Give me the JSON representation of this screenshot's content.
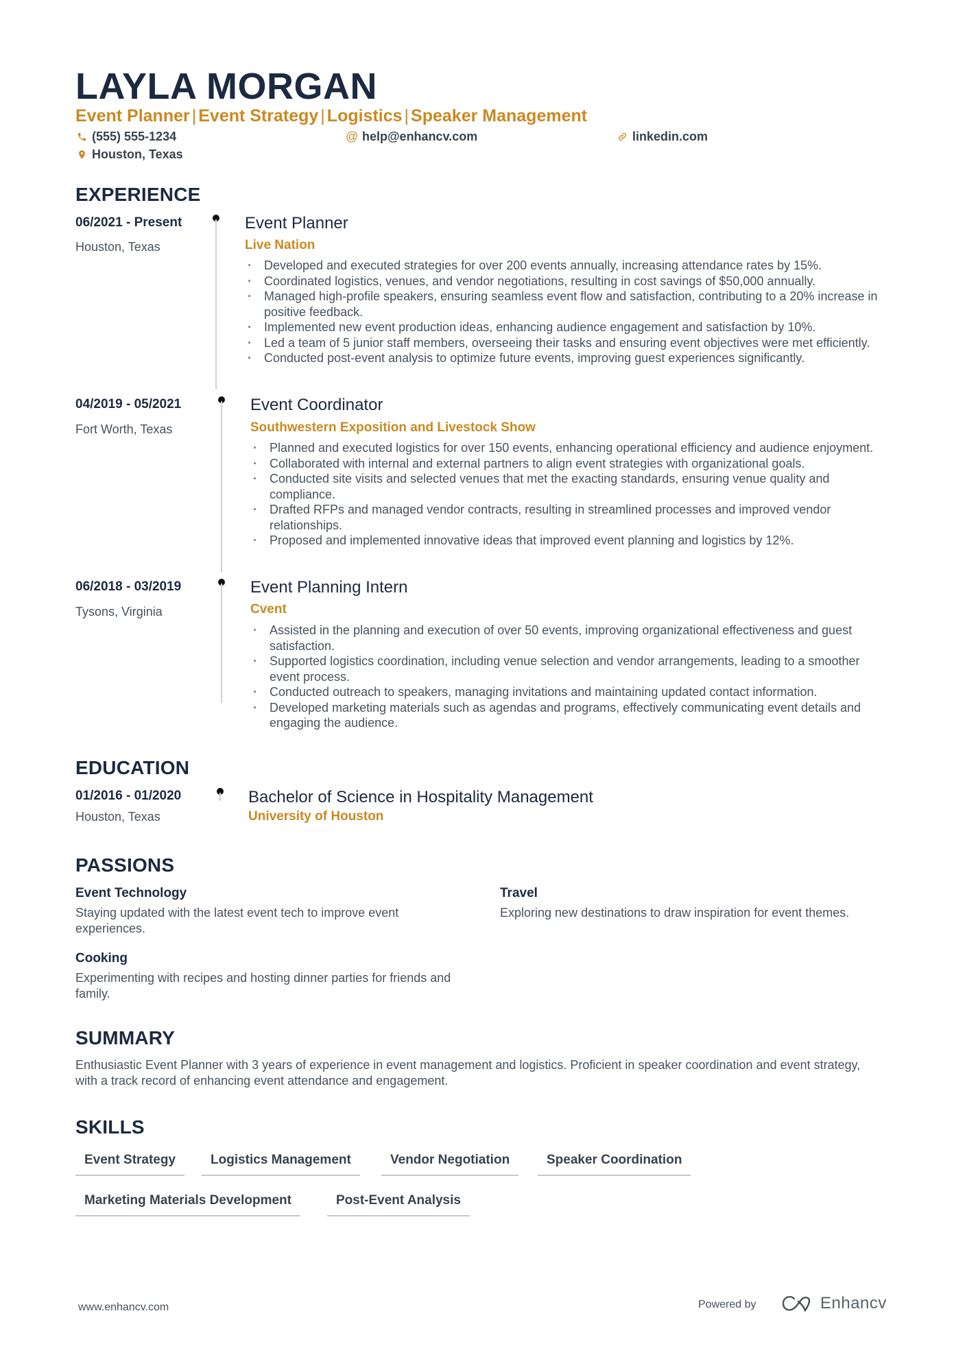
{
  "header": {
    "name": "LAYLA MORGAN",
    "headline": [
      "Event Planner",
      "Event Strategy",
      "Logistics",
      "Speaker Management"
    ],
    "headline_separator": "|",
    "phone": "(555) 555-1234",
    "email": "help@enhancv.com",
    "linkedin": "linkedin.com",
    "location": "Houston, Texas",
    "icons": {
      "phone": "phone-icon",
      "email": "at-icon",
      "linkedin": "link-icon",
      "location": "map-pin-icon"
    }
  },
  "colors": {
    "accent": "#c98a22",
    "heading": "#1b2a40",
    "body": "#4a525b"
  },
  "sections": {
    "experience": "EXPERIENCE",
    "education": "EDUCATION",
    "passions": "PASSIONS",
    "summary": "SUMMARY",
    "skills": "SKILLS"
  },
  "experience": [
    {
      "dates": "06/2021 - Present",
      "location": "Houston, Texas",
      "role": "Event Planner",
      "company": "Live Nation",
      "bullets": [
        "Developed and executed strategies for over 200 events annually, increasing attendance rates by 15%.",
        "Coordinated logistics, venues, and vendor negotiations, resulting in cost savings of $50,000 annually.",
        "Managed high-profile speakers, ensuring seamless event flow and satisfaction, contributing to a 20% increase in positive feedback.",
        "Implemented new event production ideas, enhancing audience engagement and satisfaction by 10%.",
        "Led a team of 5 junior staff members, overseeing their tasks and ensuring event objectives were met efficiently.",
        "Conducted post-event analysis to optimize future events, improving guest experiences significantly."
      ]
    },
    {
      "dates": "04/2019 - 05/2021",
      "location": "Fort Worth, Texas",
      "role": "Event Coordinator",
      "company": "Southwestern Exposition and Livestock Show",
      "bullets": [
        "Planned and executed logistics for over 150 events, enhancing operational efficiency and audience enjoyment.",
        "Collaborated with internal and external partners to align event strategies with organizational goals.",
        "Conducted site visits and selected venues that met the exacting standards, ensuring venue quality and compliance.",
        "Drafted RFPs and managed vendor contracts, resulting in streamlined processes and improved vendor relationships.",
        "Proposed and implemented innovative ideas that improved event planning and logistics by 12%."
      ]
    },
    {
      "dates": "06/2018 - 03/2019",
      "location": "Tysons, Virginia",
      "role": "Event Planning Intern",
      "company": "Cvent",
      "bullets": [
        "Assisted in the planning and execution of over 50 events, improving organizational effectiveness and guest satisfaction.",
        "Supported logistics coordination, including venue selection and vendor arrangements, leading to a smoother event process.",
        "Conducted outreach to speakers, managing invitations and maintaining updated contact information.",
        "Developed marketing materials such as agendas and programs, effectively communicating event details and engaging the audience."
      ]
    }
  ],
  "education": [
    {
      "dates": "01/2016 - 01/2020",
      "location": "Houston, Texas",
      "degree": "Bachelor of Science in Hospitality Management",
      "school": "University of Houston"
    }
  ],
  "passions": [
    {
      "title": "Event Technology",
      "description": "Staying updated with the latest event tech to improve event experiences."
    },
    {
      "title": "Travel",
      "description": "Exploring new destinations to draw inspiration for event themes."
    },
    {
      "title": "Cooking",
      "description": "Experimenting with recipes and hosting dinner parties for friends and family."
    }
  ],
  "summary": "Enthusiastic Event Planner with 3 years of experience in event management and logistics. Proficient in speaker coordination and event strategy, with a track record of enhancing event attendance and engagement.",
  "skills": [
    "Event Strategy",
    "Logistics Management",
    "Vendor Negotiation",
    "Speaker Coordination",
    "Marketing Materials Development",
    "Post-Event Analysis"
  ],
  "footer": {
    "url": "www.enhancv.com",
    "powered_by": "Powered by",
    "brand": "Enhancv"
  }
}
